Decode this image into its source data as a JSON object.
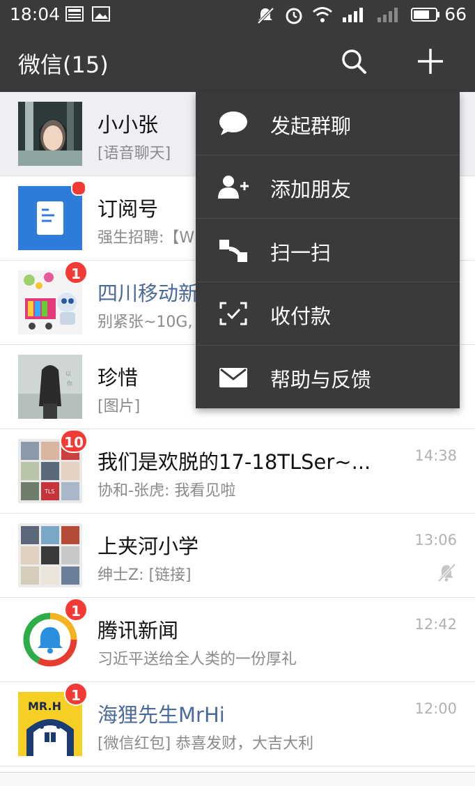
{
  "status_bar": {
    "time": "18:04",
    "battery": "66",
    "icons": [
      "news-icon",
      "image-icon",
      "mute-icon",
      "alarm-icon",
      "wifi-icon",
      "signal-icon",
      "signal-3g-icon",
      "battery-icon"
    ]
  },
  "header": {
    "title": "微信(15)",
    "icons": [
      "search-icon",
      "plus-icon"
    ]
  },
  "chats": [
    {
      "name": "小小张",
      "preview": "[语音聊天]",
      "time": "",
      "badge": "",
      "dot": false,
      "name_color": "#111111",
      "avatar": "photo-girl"
    },
    {
      "name": "订阅号",
      "preview": "强生招聘:【W",
      "time": "",
      "badge": "",
      "dot": true,
      "name_color": "#111111",
      "avatar": "subscription-icon"
    },
    {
      "name": "四川移动新",
      "preview": "别紧张~10G,",
      "time": "",
      "badge": "1",
      "dot": false,
      "name_color": "#4a6a9a",
      "avatar": "robot-cart"
    },
    {
      "name": "珍惜",
      "preview": "[图片]",
      "time": "",
      "badge": "",
      "dot": false,
      "name_color": "#111111",
      "avatar": "photo-hair"
    },
    {
      "name": "我们是欢脱的17-18TLSer~...",
      "preview": "协和-张虎: 我看见啦",
      "time": "14:38",
      "badge": "10",
      "dot": false,
      "name_color": "#111111",
      "avatar": "group-grid"
    },
    {
      "name": "上夹河小学",
      "preview": "绅士Z: [链接]",
      "time": "13:06",
      "badge": "",
      "dot": false,
      "name_color": "#111111",
      "avatar": "group-grid-2",
      "muted": true
    },
    {
      "name": "腾讯新闻",
      "preview": "习近平送给全人类的一份厚礼",
      "time": "12:42",
      "badge": "1",
      "dot": false,
      "name_color": "#111111",
      "avatar": "tencent-news-logo"
    },
    {
      "name": "海狸先生MrHi",
      "preview": "[微信红包] 恭喜发财，大吉大利",
      "time": "12:00",
      "badge": "1",
      "dot": false,
      "name_color": "#4a6a9a",
      "avatar": "beaver-logo"
    }
  ],
  "menu": {
    "items": [
      {
        "label": "发起群聊",
        "icon": "chat-bubble-icon"
      },
      {
        "label": "添加朋友",
        "icon": "add-friend-icon"
      },
      {
        "label": "扫一扫",
        "icon": "scan-icon"
      },
      {
        "label": "收付款",
        "icon": "payment-icon"
      },
      {
        "label": "帮助与反馈",
        "icon": "mail-icon"
      }
    ]
  },
  "colors": {
    "header_bg": "#3a3a3c",
    "badge_red": "#f43a35",
    "accent_blue": "#4a6a9a"
  }
}
